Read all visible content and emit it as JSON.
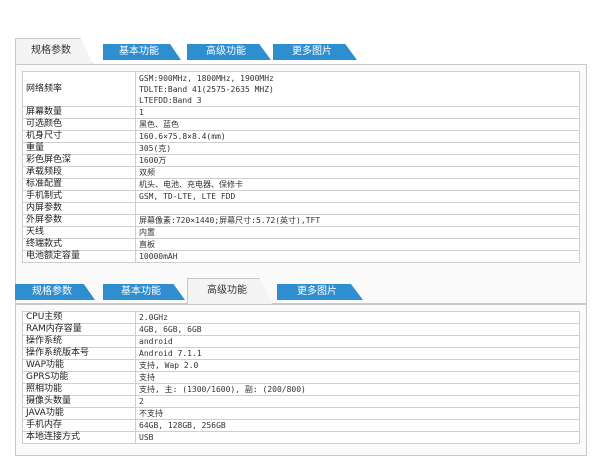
{
  "top_panel": {
    "tabs": [
      "规格参数",
      "基本功能",
      "高级功能",
      "更多图片"
    ],
    "active": 0,
    "rows": [
      {
        "k": "网络频率",
        "v": [
          "GSM:900MHz, 1800MHz, 1900MHz",
          "TDLTE:Band 41(2575-2635 MHZ)",
          "LTEFDD:Band 3"
        ]
      },
      {
        "k": "屏幕数量",
        "v": [
          "1"
        ]
      },
      {
        "k": "可选颜色",
        "v": [
          "黑色、蓝色"
        ]
      },
      {
        "k": "机身尺寸",
        "v": [
          "160.6×75.8×8.4(mm)"
        ]
      },
      {
        "k": "重量",
        "v": [
          "305(克)"
        ]
      },
      {
        "k": "彩色屏色深",
        "v": [
          "1600万"
        ]
      },
      {
        "k": "承载频段",
        "v": [
          "双频"
        ]
      },
      {
        "k": "标准配置",
        "v": [
          "机头、电池、充电器、保修卡"
        ]
      },
      {
        "k": "手机制式",
        "v": [
          "GSM, TD-LTE, LTE FDD"
        ]
      },
      {
        "k": "内屏参数",
        "v": [
          ""
        ]
      },
      {
        "k": "外屏参数",
        "v": [
          "屏幕像素:720×1440;屏幕尺寸:5.72(英寸),TFT"
        ]
      },
      {
        "k": "天线",
        "v": [
          "内置"
        ]
      },
      {
        "k": "终端款式",
        "v": [
          "直板"
        ]
      },
      {
        "k": "电池额定容量",
        "v": [
          "10000mAH"
        ]
      }
    ]
  },
  "bottom_panel": {
    "tabs": [
      "规格参数",
      "基本功能",
      "高级功能",
      "更多图片"
    ],
    "active": 2,
    "rows": [
      {
        "k": "CPU主频",
        "v": [
          "2.0GHz"
        ]
      },
      {
        "k": "RAM内存容量",
        "v": [
          "4GB, 6GB, 6GB"
        ]
      },
      {
        "k": "操作系统",
        "v": [
          "android"
        ]
      },
      {
        "k": "操作系统版本号",
        "v": [
          "Android 7.1.1"
        ]
      },
      {
        "k": "WAP功能",
        "v": [
          "支持, Wap 2.0"
        ]
      },
      {
        "k": "GPRS功能",
        "v": [
          "支持"
        ]
      },
      {
        "k": "照相功能",
        "v": [
          "支持, 主: (1300/1600), 副: (200/800)"
        ]
      },
      {
        "k": "摄像头数量",
        "v": [
          "2"
        ]
      },
      {
        "k": "JAVA功能",
        "v": [
          "不支持"
        ]
      },
      {
        "k": "手机内存",
        "v": [
          "64GB, 128GB, 256GB"
        ]
      },
      {
        "k": "本地连接方式",
        "v": [
          "USB"
        ]
      }
    ]
  }
}
